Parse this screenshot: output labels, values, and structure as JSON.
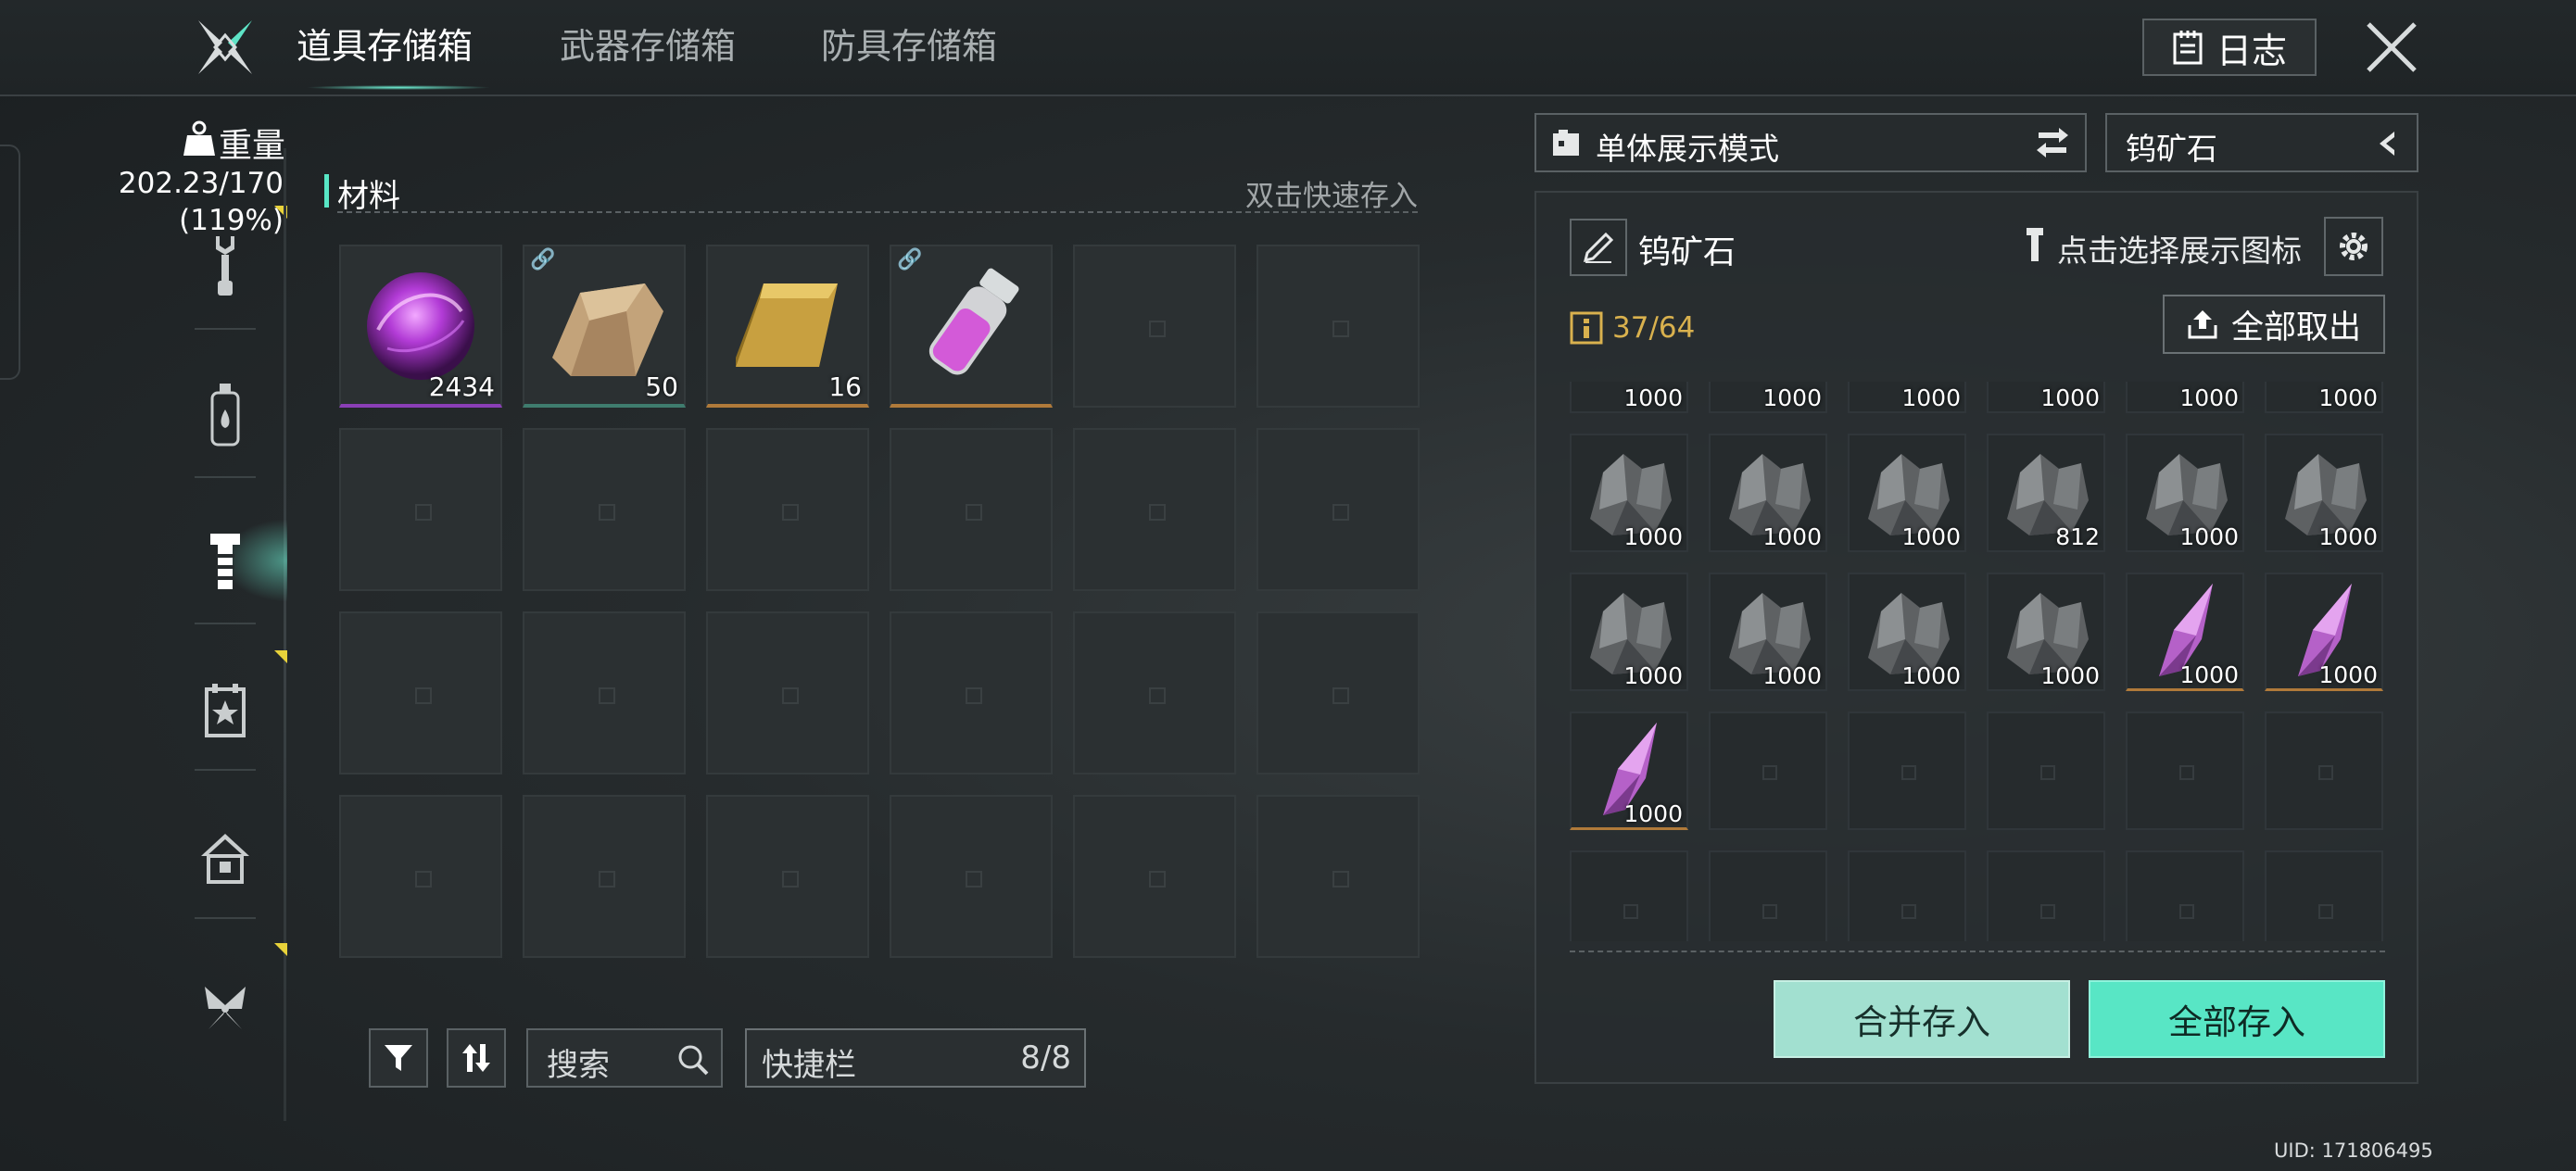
{
  "header": {
    "tabs": [
      {
        "label": "道具存储箱",
        "active": true
      },
      {
        "label": "武器存储箱",
        "active": false
      },
      {
        "label": "防具存储箱",
        "active": false
      }
    ],
    "log_label": "日志"
  },
  "sidebar": {
    "weight_label": "重量",
    "weight_value": "202.23/170",
    "weight_percent": "(119%)",
    "items": [
      {
        "icon": "wrench-icon"
      },
      {
        "icon": "bottle-icon"
      },
      {
        "icon": "bolt-icon",
        "active": true
      },
      {
        "icon": "event-card-icon"
      },
      {
        "icon": "house-icon"
      },
      {
        "icon": "butterfly-emblem-icon"
      }
    ]
  },
  "storage": {
    "section_title": "材料",
    "quick_store_hint": "双击快速存入",
    "items": [
      {
        "name": "purple-orb",
        "qty": "2434",
        "rarity": "purple",
        "linked": false
      },
      {
        "name": "cloth-bundle",
        "qty": "50",
        "rarity": "green",
        "linked": true
      },
      {
        "name": "gold-ingot",
        "qty": "16",
        "rarity": "gold",
        "linked": false
      },
      {
        "name": "purple-vial",
        "qty": "",
        "rarity": "gold",
        "linked": true
      }
    ]
  },
  "toolbar": {
    "search_placeholder": "搜索",
    "quickbar_label": "快捷栏",
    "quickbar_count": "8/8"
  },
  "detail": {
    "mode_label": "单体展示模式",
    "selected_filter": "钨矿石",
    "item_name": "钨矿石",
    "pick_icon_hint": "点击选择展示图标",
    "capacity": "37/64",
    "take_all_label": "全部取出",
    "partial_row_qty": [
      "1000",
      "1000",
      "1000",
      "1000",
      "1000",
      "1000"
    ],
    "slots": [
      {
        "type": "tungsten",
        "qty": "1000"
      },
      {
        "type": "tungsten",
        "qty": "1000"
      },
      {
        "type": "tungsten",
        "qty": "1000"
      },
      {
        "type": "tungsten",
        "qty": "812"
      },
      {
        "type": "tungsten",
        "qty": "1000"
      },
      {
        "type": "tungsten",
        "qty": "1000"
      },
      {
        "type": "tungsten",
        "qty": "1000"
      },
      {
        "type": "tungsten",
        "qty": "1000"
      },
      {
        "type": "tungsten",
        "qty": "1000"
      },
      {
        "type": "tungsten",
        "qty": "1000"
      },
      {
        "type": "crystal",
        "qty": "1000"
      },
      {
        "type": "crystal",
        "qty": "1000"
      },
      {
        "type": "crystal",
        "qty": "1000"
      }
    ],
    "merge_store_label": "合并存入",
    "store_all_label": "全部存入"
  },
  "footer": {
    "uid": "UID: 171806495"
  },
  "colors": {
    "accent": "#58e6c5",
    "gold_text": "#d9b14e",
    "rarity_purple": "#8a3fb6",
    "rarity_gold": "#b07a3a",
    "rarity_green": "#3f7c6e"
  }
}
